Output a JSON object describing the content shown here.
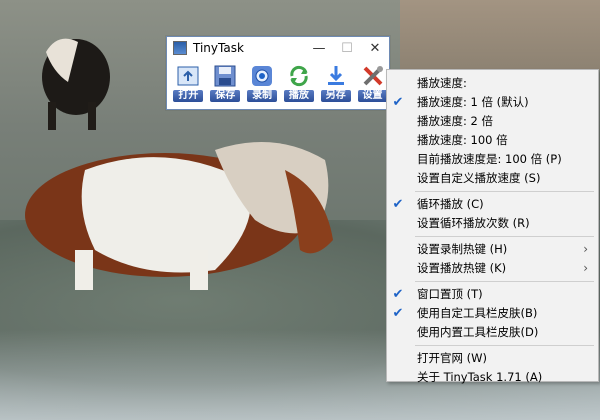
{
  "window": {
    "title": "TinyTask",
    "controls": {
      "minimize": "—",
      "maximize": "☐",
      "close": "✕"
    },
    "toolbar": [
      {
        "id": "open",
        "label": "打开",
        "icon": "open-icon"
      },
      {
        "id": "save",
        "label": "保存",
        "icon": "save-icon"
      },
      {
        "id": "record",
        "label": "录制",
        "icon": "record-icon"
      },
      {
        "id": "play",
        "label": "播放",
        "icon": "play-icon"
      },
      {
        "id": "saveas",
        "label": "另存",
        "icon": "export-icon"
      },
      {
        "id": "settings",
        "label": "设置",
        "icon": "tools-icon"
      }
    ]
  },
  "menu": {
    "items": [
      {
        "type": "item",
        "label": "播放速度:",
        "checked": false
      },
      {
        "type": "item",
        "label": "播放速度:   1 倍 (默认)",
        "checked": true
      },
      {
        "type": "item",
        "label": "播放速度:   2 倍",
        "checked": false
      },
      {
        "type": "item",
        "label": "播放速度:   100 倍",
        "checked": false
      },
      {
        "type": "item",
        "label": "目前播放速度是: 100 倍 (P)",
        "checked": false
      },
      {
        "type": "item",
        "label": "设置自定义播放速度 (S)",
        "checked": false
      },
      {
        "type": "sep"
      },
      {
        "type": "item",
        "label": "循环播放 (C)",
        "checked": true
      },
      {
        "type": "item",
        "label": "设置循环播放次数 (R)",
        "checked": false
      },
      {
        "type": "sep"
      },
      {
        "type": "item",
        "label": "设置录制热键 (H)",
        "checked": false,
        "submenu": true
      },
      {
        "type": "item",
        "label": "设置播放热键 (K)",
        "checked": false,
        "submenu": true
      },
      {
        "type": "sep"
      },
      {
        "type": "item",
        "label": "窗口置顶 (T)",
        "checked": true
      },
      {
        "type": "item",
        "label": "使用自定工具栏皮肤(B)",
        "checked": true
      },
      {
        "type": "item",
        "label": "使用内置工具栏皮肤(D)",
        "checked": false
      },
      {
        "type": "sep"
      },
      {
        "type": "item",
        "label": "打开官网 (W)",
        "checked": false
      },
      {
        "type": "item",
        "label": "关于 TinyTask 1.71 (A)",
        "checked": false
      }
    ],
    "check_glyph": "✔",
    "submenu_glyph": "›"
  },
  "colors": {
    "accent": "#1e63c7",
    "menu_bg": "#f2f2f2",
    "toolbar_label_bg": "#2c4e98"
  }
}
